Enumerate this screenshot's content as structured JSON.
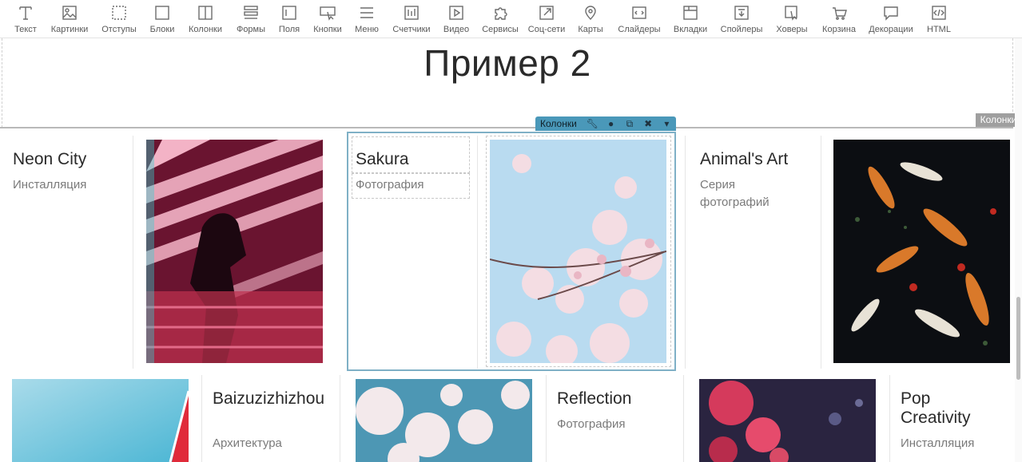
{
  "toolbar": {
    "items": [
      {
        "label": "Текст",
        "icon": "text-icon"
      },
      {
        "label": "Картинки",
        "icon": "image-icon"
      },
      {
        "label": "Отступы",
        "icon": "padding-icon"
      },
      {
        "label": "Блоки",
        "icon": "block-icon"
      },
      {
        "label": "Колонки",
        "icon": "columns-icon"
      },
      {
        "label": "Формы",
        "icon": "form-icon"
      },
      {
        "label": "Поля",
        "icon": "field-icon"
      },
      {
        "label": "Кнопки",
        "icon": "button-icon"
      },
      {
        "label": "Меню",
        "icon": "menu-icon"
      },
      {
        "label": "Счетчики",
        "icon": "counter-icon"
      },
      {
        "label": "Видео",
        "icon": "video-icon"
      },
      {
        "label": "Сервисы",
        "icon": "puzzle-icon"
      },
      {
        "label": "Соц-сети",
        "icon": "share-icon"
      },
      {
        "label": "Карты",
        "icon": "map-pin-icon"
      },
      {
        "label": "Слайдеры",
        "icon": "slider-icon"
      },
      {
        "label": "Вкладки",
        "icon": "tabs-icon"
      },
      {
        "label": "Спойлеры",
        "icon": "spoiler-icon"
      },
      {
        "label": "Ховеры",
        "icon": "hover-icon"
      },
      {
        "label": "Корзина",
        "icon": "cart-icon"
      },
      {
        "label": "Декорации",
        "icon": "speech-bubble-icon"
      },
      {
        "label": "HTML",
        "icon": "html-icon"
      }
    ]
  },
  "page": {
    "title": "Пример 2",
    "section_label": "Колонки"
  },
  "column_toolbar": {
    "label": "Колонки",
    "icons": [
      "wrench-icon",
      "drop-icon",
      "copy-icon",
      "close-icon",
      "caret-down-icon"
    ]
  },
  "cards": [
    {
      "title": "Neon City",
      "subtitle": "Инсталляция"
    },
    {
      "title": "Sakura",
      "subtitle": "Фотография"
    },
    {
      "title": "Animal's Art",
      "subtitle": "Серия фотографий"
    },
    {
      "title": "Baizuzizhizhou",
      "subtitle": "Архитектура"
    },
    {
      "title": "Reflection",
      "subtitle": "Фотография"
    },
    {
      "title": "Pop Creativity",
      "subtitle": "Инсталляция"
    }
  ],
  "colors": {
    "accent": "#4a98b9",
    "selection": "#7fb0c6"
  }
}
